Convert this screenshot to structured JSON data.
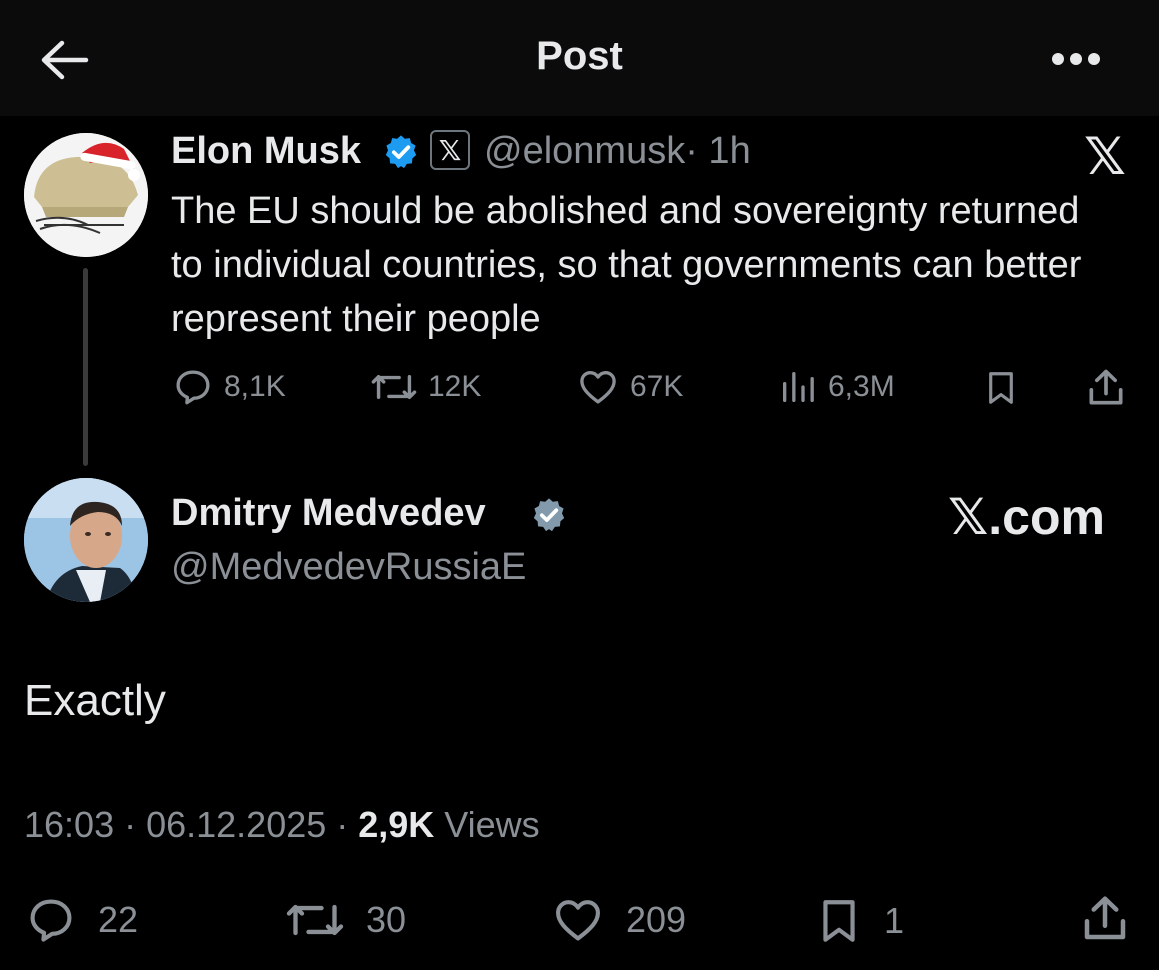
{
  "header": {
    "title": "Post",
    "back_icon": "arrow-left-icon",
    "more_icon": "more-horizontal-icon"
  },
  "parent_post": {
    "author_name": "Elon Musk",
    "badge_letter": "𝕏",
    "handle": "@elonmusk",
    "time": "· 1h",
    "text": "The EU should be abolished and sovereignty returned to individual countries, so that governments can better represent their people",
    "x_logo": "𝕏",
    "stats": {
      "replies": "8,1K",
      "reposts": "12K",
      "likes": "67K",
      "views": "6,3M"
    }
  },
  "main_post": {
    "author_name": "Dmitry Medvedev",
    "handle": "@MedvedevRussiaE",
    "watermark": "𝕏.com",
    "text": "Exactly",
    "timestamp": "16:03 · 06.12.2025 · ",
    "views_count": "2,9K",
    "views_label": " Views",
    "stats": {
      "replies": "22",
      "reposts": "30",
      "likes": "209",
      "bookmarks": "1"
    }
  },
  "colors": {
    "background": "#000000",
    "text_primary": "#e7e9ea",
    "text_secondary": "#8b9096",
    "verified_blue": "#1d9bf0",
    "verified_gray": "#829aab"
  }
}
